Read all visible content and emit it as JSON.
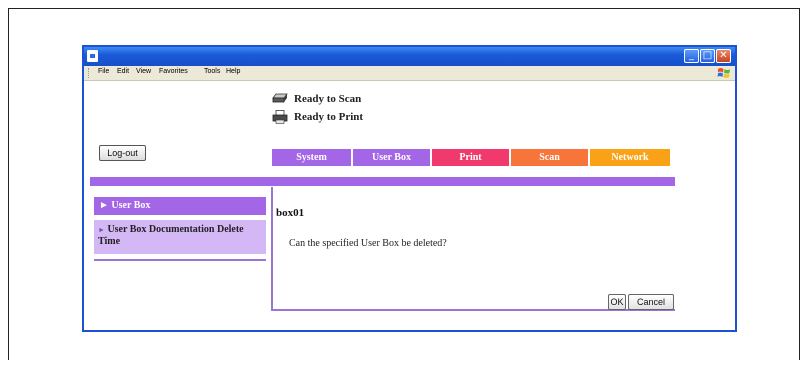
{
  "window": {
    "menu": [
      "File",
      "Edit",
      "View",
      "Favorites",
      "Tools",
      "Help"
    ],
    "controls": {
      "minimize": "_",
      "maximize": "□",
      "close": "✕"
    },
    "colors": {
      "titlebar": "#1c5ad9"
    }
  },
  "status": {
    "scan": "Ready to Scan",
    "print": "Ready to Print"
  },
  "logout_label": "Log-out",
  "tabs": [
    {
      "label": "System",
      "color": "#a266e6"
    },
    {
      "label": "User Box",
      "color": "#a266e6"
    },
    {
      "label": "Print",
      "color": "#f03a6e"
    },
    {
      "label": "Scan",
      "color": "#f7743a"
    },
    {
      "label": "Network",
      "color": "#f9a218"
    }
  ],
  "sidebar": {
    "items": [
      {
        "label": "User Box",
        "selected": true
      },
      {
        "label": "User Box Documentation Delete Time",
        "selected": false
      }
    ]
  },
  "main": {
    "box_name": "box01",
    "question": "Can the specified User Box be deleted?",
    "ok_label": "OK",
    "cancel_label": "Cancel"
  }
}
